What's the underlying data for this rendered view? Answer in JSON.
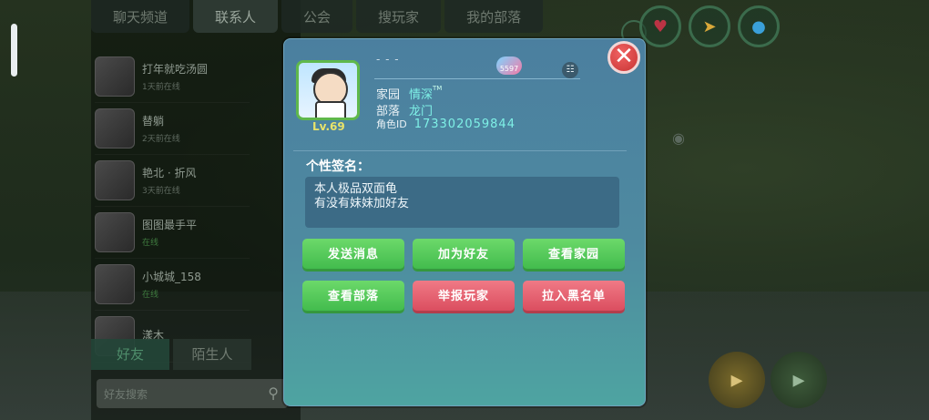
{
  "left_panel": {
    "top_tabs": [
      "聊天频道",
      "联系人",
      "公会",
      "搜玩家",
      "我的部落"
    ],
    "contacts": [
      {
        "name": "打年就吃汤圆",
        "sub": "1天前在线"
      },
      {
        "name": "替躺",
        "sub": "2天前在线"
      },
      {
        "name": "艳北 · 折风",
        "sub": "3天前在线"
      },
      {
        "name": "图图最手平",
        "sub": "在线"
      },
      {
        "name": "小城城_158",
        "sub": "在线"
      },
      {
        "name": "漾木",
        "sub": ""
      }
    ],
    "bottom_tabs": [
      "好友",
      "陌生人"
    ],
    "search_placeholder": "好友搜索"
  },
  "profile": {
    "level": "Lv.69",
    "name_placeholder": "- - -",
    "heart_count": "5597",
    "home_label": "家园",
    "home_value": "情深",
    "home_mark": "TM",
    "tribe_label": "部落",
    "tribe_value": "龙门",
    "role_id_label": "角色ID",
    "role_id_value": "173302059844",
    "signature_title": "个性签名：",
    "signature_line1": "本人极品双面龟",
    "signature_line2": "有没有妹妹加好友"
  },
  "buttons": {
    "send_message": "发送消息",
    "add_friend": "加为好友",
    "view_home": "查看家园",
    "view_tribe": "查看部落",
    "report_player": "举报玩家",
    "add_blacklist": "拉入黑名单"
  },
  "icons": {
    "close": "close-icon",
    "copy": "copy-icon",
    "search": "search-icon",
    "heart": "heart-icon"
  },
  "colors": {
    "dialog": "#4e8aa0",
    "green_button": "#4fc15a",
    "red_button": "#e25c6c",
    "accent_value": "#7ef0e6",
    "level": "#e8e36a"
  }
}
